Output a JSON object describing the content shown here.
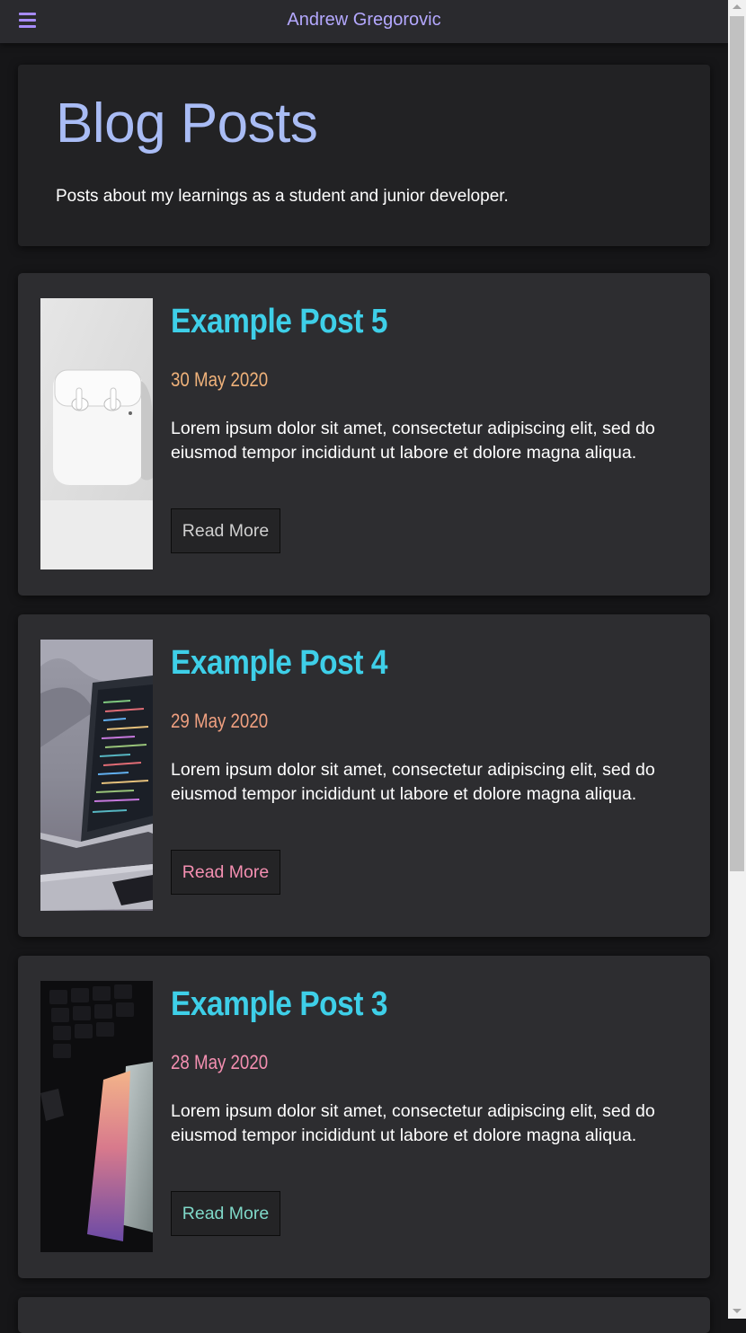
{
  "nav": {
    "menu_icon": "hamburger-menu-icon",
    "site_title": "Andrew Gregorovic",
    "accent_color": "#a78bfa"
  },
  "hero": {
    "heading": "Blog Posts",
    "subtitle": "Posts about my learnings as a student and junior developer."
  },
  "posts": [
    {
      "title": "Example Post 5",
      "date": "30 May 2020",
      "date_color": "#f0b27a",
      "excerpt": "Lorem ipsum dolor sit amet, consectetur adipiscing elit, sed do eiusmod tempor incididunt ut labore et dolore magna aliqua.",
      "read_more": "Read More",
      "read_more_color": "#cfcfcf",
      "image": "airpods-photo"
    },
    {
      "title": "Example Post 4",
      "date": "29 May 2020",
      "date_color": "#f0a080",
      "excerpt": "Lorem ipsum dolor sit amet, consectetur adipiscing elit, sed do eiusmod tempor incididunt ut labore et dolore magna aliqua.",
      "read_more": "Read More",
      "read_more_color": "#f48fb1",
      "image": "laptop-code-photo"
    },
    {
      "title": "Example Post 3",
      "date": "28 May 2020",
      "date_color": "#f48fb1",
      "excerpt": "Lorem ipsum dolor sit amet, consectetur adipiscing elit, sed do eiusmod tempor incididunt ut labore et dolore magna aliqua.",
      "read_more": "Read More",
      "read_more_color": "#7fd8c8",
      "image": "phone-keyboard-photo"
    }
  ],
  "colors": {
    "background": "#161618",
    "card": "#2d2d30",
    "post_title": "#3ecfe8",
    "hero_heading": "#a9bcf5"
  }
}
